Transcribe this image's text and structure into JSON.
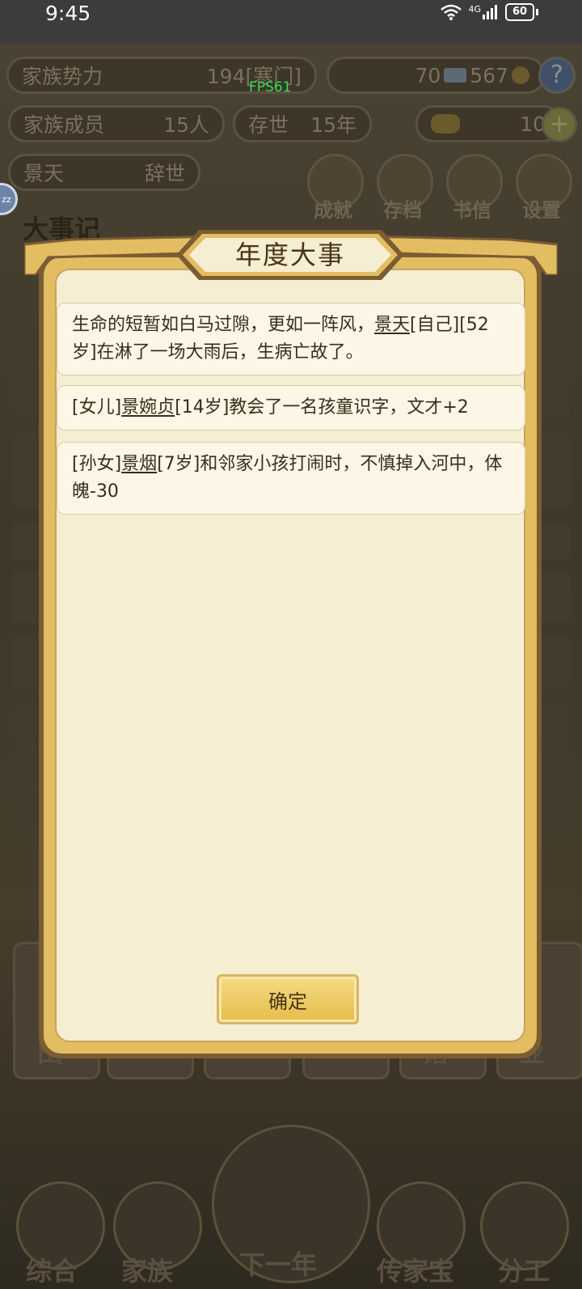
{
  "status_bar": {
    "time": "9:45",
    "network": "4G",
    "battery": "60"
  },
  "fps": "FPS61",
  "stats": {
    "clan_power_label": "家族势力",
    "clan_power_value": "194",
    "clan_power_rank": "[寒门]",
    "resource_a": "70",
    "resource_b": "567",
    "members_label": "家族成员",
    "members_value": "15人",
    "existence_label": "存世",
    "existence_value": "15年",
    "gold_ingots": "10",
    "person_name": "景天",
    "person_status": "辞世"
  },
  "top_menu": [
    {
      "label": "成就"
    },
    {
      "label": "存档"
    },
    {
      "label": "书信"
    },
    {
      "label": "设置"
    }
  ],
  "background_title": "大事记",
  "bottom_side_chars": {
    "left": "田",
    "mid": "馆",
    "right": "业"
  },
  "bottom_nav": [
    {
      "label": "综合"
    },
    {
      "label": "家族"
    },
    {
      "label": "下一年"
    },
    {
      "label": "传家宝"
    },
    {
      "label": "分工"
    }
  ],
  "dialog": {
    "title": "年度大事",
    "events": [
      {
        "pre": "生命的短暂如白马过隙，更如一阵风，",
        "name": "景天",
        "post": "[自己][52岁]在淋了一场大雨后，生病亡故了。"
      },
      {
        "pre": "[女儿]",
        "name": "景婉贞",
        "post": "[14岁]教会了一名孩童识字，文才+2"
      },
      {
        "pre": "[孙女]",
        "name": "景烟",
        "post": "[7岁]和邻家小孩打闹时，不慎掉入河中，体魄-30"
      }
    ],
    "confirm_label": "确定"
  },
  "colors": {
    "dialog_bg": "#f6eed2",
    "gold_border": "#e2bd62",
    "fps_green": "#33dd55"
  }
}
